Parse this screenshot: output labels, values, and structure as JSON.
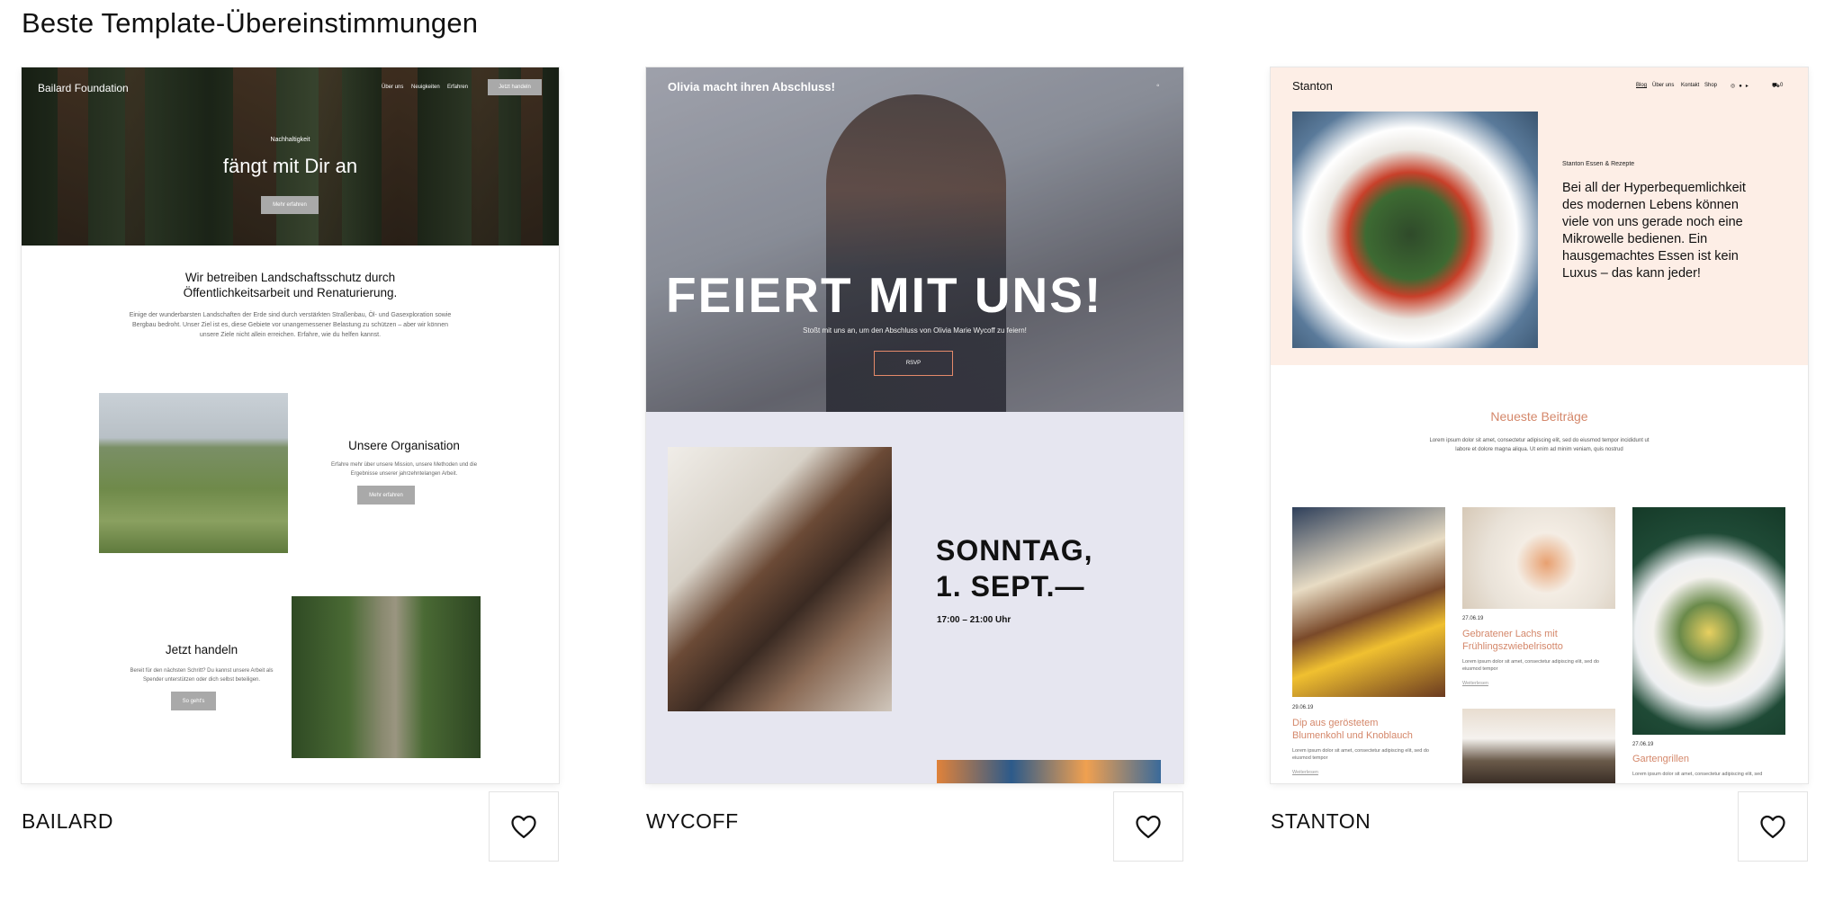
{
  "page": {
    "heading": "Beste Template-Übereinstimmungen"
  },
  "templates": [
    {
      "name": "BAILARD",
      "preview": {
        "brand": "Bailard Foundation",
        "nav": [
          "Über uns",
          "Neuigkeiten",
          "Erfahren"
        ],
        "nav_button": "Jetzt handeln",
        "hero_kicker": "Nachhaltigkeit",
        "hero_title": "fängt mit Dir an",
        "hero_button": "Mehr erfahren",
        "intro_title_1": "Wir betreiben Landschaftsschutz durch",
        "intro_title_2": "Öffentlichkeitsarbeit und Renaturierung.",
        "intro_text_1": "Einige der wunderbarsten Landschaften der Erde sind durch verstärkten Straßenbau, Öl- und Gasexploration sowie",
        "intro_text_2": "Bergbau bedroht. Unser Ziel ist es, diese Gebiete vor unangemessener Belastung zu schützen – aber wir können",
        "intro_text_3": "unsere Ziele nicht allein erreichen. Erfahre, wie du helfen kannst.",
        "org_title": "Unsere Organisation",
        "org_text_1": "Erfahre mehr über unsere Mission, unsere Methoden und die",
        "org_text_2": "Ergebnisse unserer jahrzehntelangen Arbeit.",
        "org_button": "Mehr erfahren",
        "act_title": "Jetzt handeln",
        "act_text_1": "Bereit für den nächsten Schritt? Du kannst unsere Arbeit als",
        "act_text_2": "Spender unterstützen oder dich selbst beteiligen.",
        "act_button": "So geht's"
      }
    },
    {
      "name": "WYCOFF",
      "preview": {
        "header": "Olivia macht ihren Abschluss!",
        "hero_title": "FEIERT MIT UNS!",
        "hero_sub": "Stoßt mit uns an, um den Abschluss von Olivia Marie Wycoff zu feiern!",
        "hero_button": "RSVP",
        "date_1": "SONNTAG,",
        "date_2": "1. SEPT.—",
        "time": "17:00 – 21:00 Uhr"
      }
    },
    {
      "name": "STANTON",
      "preview": {
        "brand": "Stanton",
        "nav": [
          "Blog",
          "Über uns",
          "Kontakt",
          "Shop"
        ],
        "cart_count": "0",
        "kicker": "Stanton Essen & Rezepte",
        "headline_1": "Bei all der Hyperbequemlichkeit",
        "headline_2": "des modernen Lebens können",
        "headline_3": "viele von uns gerade noch eine",
        "headline_4": "Mikrowelle bedienen. Ein",
        "headline_5": "hausgemachtes Essen ist kein",
        "headline_6": "Luxus – das kann jeder!",
        "section_title": "Neueste Beiträge",
        "section_text_1": "Lorem ipsum dolor sit amet, consectetur adipiscing elit, sed do eiusmod tempor incididunt ut",
        "section_text_2": "labore et dolore magna aliqua. Ut enim ad minim veniam, quis nostrud",
        "posts": [
          {
            "date": "29.06.19",
            "title_1": "Dip aus geröstetem",
            "title_2": "Blumenkohl und Knoblauch",
            "text": "Lorem ipsum dolor sit amet, consectetur adipiscing elit, sed do eiusmod tempor",
            "more": "Weiterlesen"
          },
          {
            "date": "27.06.19",
            "title_1": "Gebratener Lachs mit",
            "title_2": "Frühlingszwiebelrisotto",
            "text": "Lorem ipsum dolor sit amet, consectetur adipiscing elit, sed do eiusmod tempor",
            "more": "Weiterlesen"
          },
          {
            "date": "27.06.19",
            "title_1": "Gartengrillen",
            "title_2": "",
            "text": "Lorem ipsum dolor sit amet, consectetur adipiscing elit, sed",
            "more": "Weiterlesen"
          }
        ]
      }
    }
  ],
  "colors": {
    "accent_salmon": "#d4876a",
    "stanton_bg": "#fdeee6",
    "wycoff_bg": "#e6e6f0"
  },
  "icons": {
    "favorite": "heart-outline-icon"
  }
}
